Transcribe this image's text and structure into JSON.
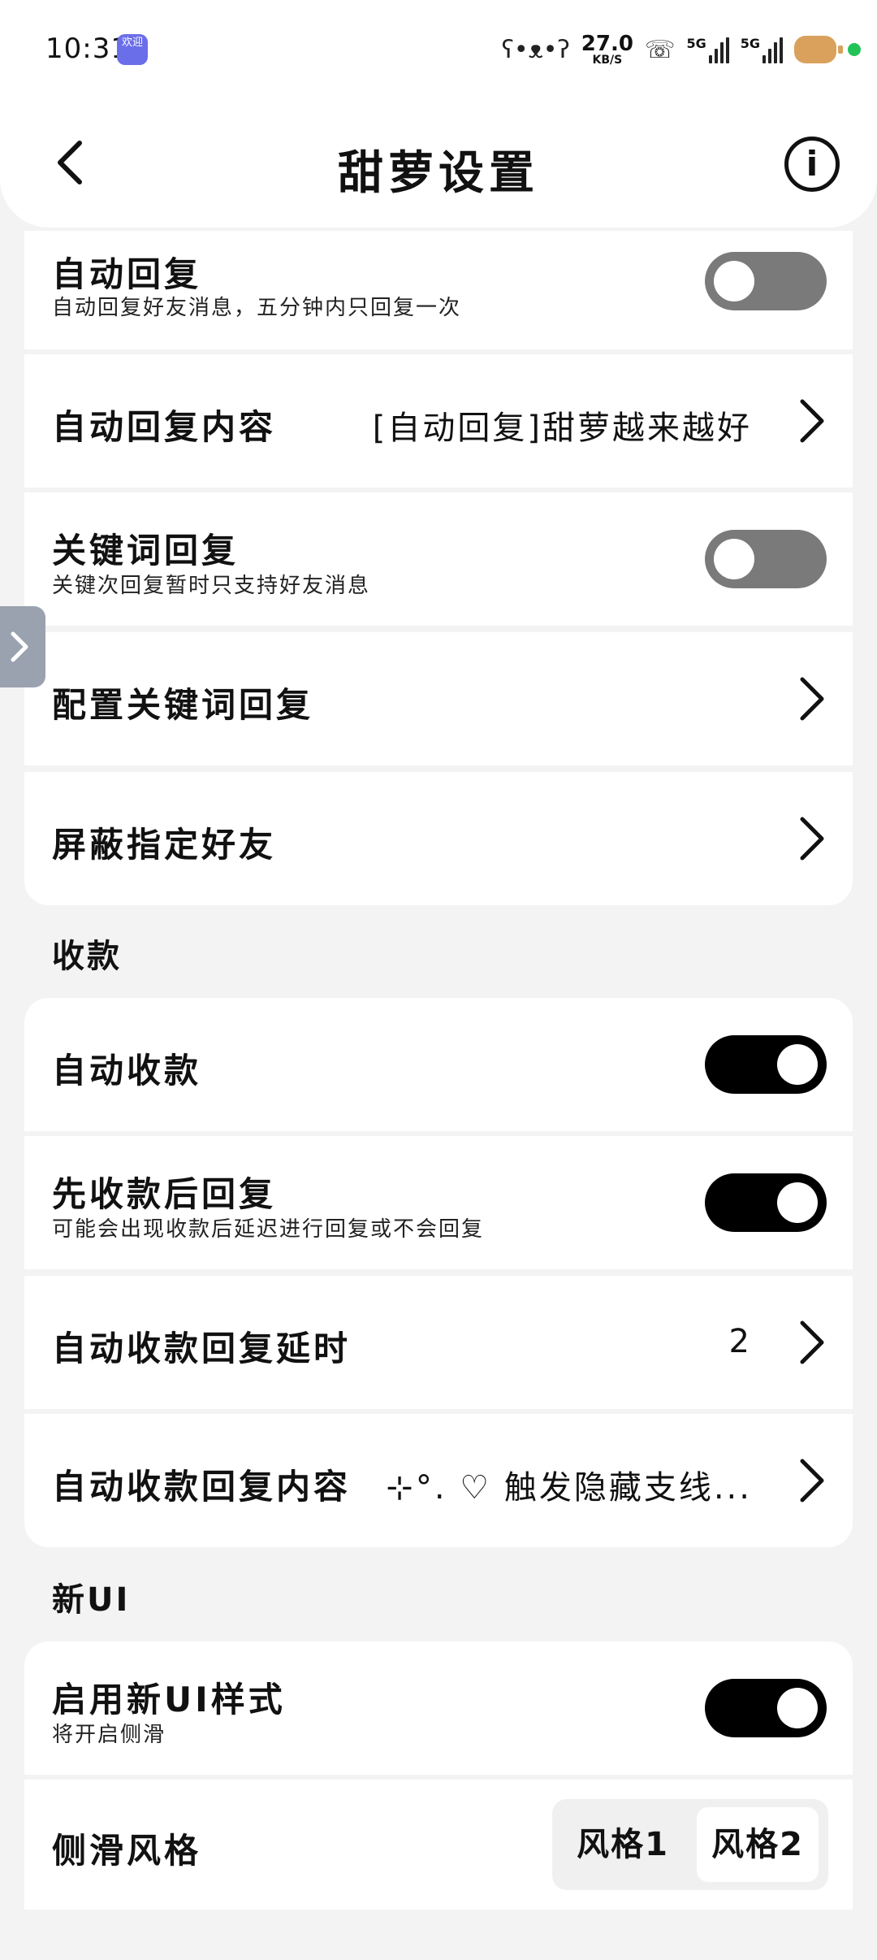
{
  "status_bar": {
    "time": "10:31",
    "app_icon_label": "欢迎",
    "net_speed_value": "27.0",
    "net_speed_unit": "KB/S",
    "signal1_label": "5G",
    "signal2_label": "5G"
  },
  "header": {
    "title": "甜萝设置"
  },
  "group1": [
    {
      "title": "自动回复",
      "subtitle": "自动回复好友消息，五分钟内只回复一次",
      "toggle": "off"
    },
    {
      "title": "自动回复内容",
      "value": "[自动回复]甜萝越来越好"
    },
    {
      "title": "关键词回复",
      "subtitle": "关键次回复暂时只支持好友消息",
      "toggle": "off"
    },
    {
      "title": "配置关键词回复"
    },
    {
      "title": "屏蔽指定好友"
    }
  ],
  "section_payment": "收款",
  "group2": [
    {
      "title": "自动收款",
      "toggle": "on"
    },
    {
      "title": "先收款后回复",
      "subtitle": "可能会出现收款后延迟进行回复或不会回复",
      "toggle": "on"
    },
    {
      "title": "自动收款回复延时",
      "value": "2"
    },
    {
      "title": "自动收款回复内容",
      "value": "⊹°. ♡ 触发隐藏支线..."
    }
  ],
  "section_newui": "新UI",
  "group3": [
    {
      "title": "启用新UI样式",
      "subtitle": "将开启侧滑",
      "toggle": "on"
    },
    {
      "title": "侧滑风格",
      "options": [
        "风格1",
        "风格2"
      ],
      "selected": "风格2"
    }
  ],
  "colors": {
    "background": "#f3f3f3",
    "card": "#ffffff",
    "toggle_on": "#000000",
    "toggle_off": "#7a7a7a"
  }
}
